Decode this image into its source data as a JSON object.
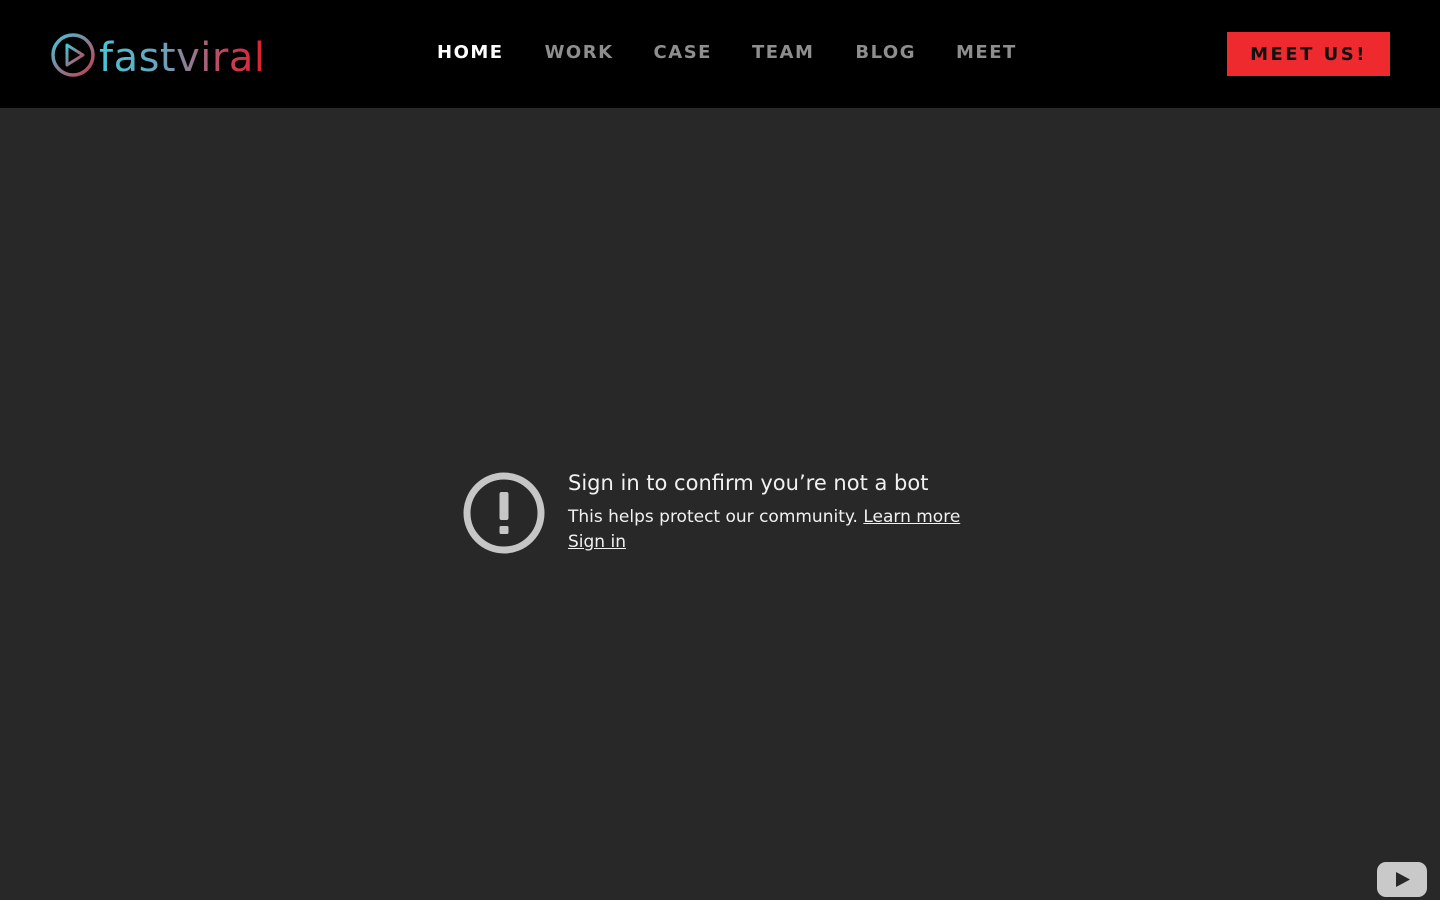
{
  "brand": {
    "name": "fastviral",
    "icon": "play-circle-icon"
  },
  "nav": {
    "items": [
      {
        "label": "HOME",
        "active": true
      },
      {
        "label": "WORK",
        "active": false
      },
      {
        "label": "CASE",
        "active": false
      },
      {
        "label": "TEAM",
        "active": false
      },
      {
        "label": "BLOG",
        "active": false
      },
      {
        "label": "MEET",
        "active": false
      }
    ]
  },
  "cta": {
    "label": "MEET US!"
  },
  "embed": {
    "icon": "alert-circle-icon",
    "title": "Sign in to confirm you’re not a bot",
    "message": "This helps protect our community.",
    "learn_more": "Learn more",
    "sign_in": "Sign in",
    "player_icon": "youtube-logo-icon"
  },
  "colors": {
    "header_bg": "#000000",
    "page_bg": "#282828",
    "accent": "#ee2a2e",
    "nav_active": "#ffffff",
    "nav_inactive": "#8e8e8e",
    "brand_teal": "#45c6d8",
    "brand_red": "#e0202c"
  }
}
